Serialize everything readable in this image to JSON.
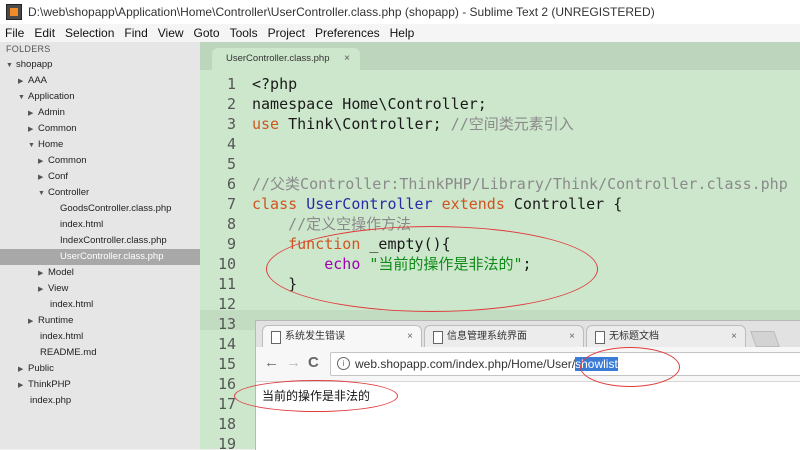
{
  "window": {
    "title": "D:\\web\\shopapp\\Application\\Home\\Controller\\UserController.class.php (shopapp) - Sublime Text 2 (UNREGISTERED)"
  },
  "menu": [
    "File",
    "Edit",
    "Selection",
    "Find",
    "View",
    "Goto",
    "Tools",
    "Project",
    "Preferences",
    "Help"
  ],
  "sidebar": {
    "header": "FOLDERS",
    "items": [
      {
        "label": "shopapp",
        "arrow": "▼"
      },
      {
        "label": "AAA",
        "arrow": "▶"
      },
      {
        "label": "Application",
        "arrow": "▼"
      },
      {
        "label": "Admin",
        "arrow": "▶"
      },
      {
        "label": "Common",
        "arrow": "▶"
      },
      {
        "label": "Home",
        "arrow": "▼"
      },
      {
        "label": "Common",
        "arrow": "▶"
      },
      {
        "label": "Conf",
        "arrow": "▶"
      },
      {
        "label": "Controller",
        "arrow": "▼"
      },
      {
        "label": "GoodsController.class.php",
        "arrow": ""
      },
      {
        "label": "index.html",
        "arrow": ""
      },
      {
        "label": "IndexController.class.php",
        "arrow": ""
      },
      {
        "label": "UserController.class.php",
        "arrow": "",
        "selected": true
      },
      {
        "label": "Model",
        "arrow": "▶"
      },
      {
        "label": "View",
        "arrow": "▶"
      },
      {
        "label": "index.html",
        "arrow": ""
      },
      {
        "label": "Runtime",
        "arrow": "▶"
      },
      {
        "label": "index.html",
        "arrow": ""
      },
      {
        "label": "README.md",
        "arrow": ""
      },
      {
        "label": "Public",
        "arrow": "▶"
      },
      {
        "label": "ThinkPHP",
        "arrow": "▶"
      },
      {
        "label": "index.php",
        "arrow": ""
      }
    ]
  },
  "editor": {
    "tab_label": "UserController.class.php",
    "tab_close": "×",
    "line_numbers": [
      "1",
      "2",
      "3",
      "4",
      "5",
      "6",
      "7",
      "8",
      "9",
      "10",
      "11",
      "12",
      "13",
      "14",
      "15",
      "16",
      "17",
      "18",
      "19"
    ],
    "code": {
      "l1": "<?php",
      "l2": "namespace Home\\Controller;",
      "l3_kw": "use",
      "l3_rest": " Think\\Controller; ",
      "l3_cmt": "//空间类元素引入",
      "l6_cmt": "//父类Controller:ThinkPHP/Library/Think/Controller.class.php",
      "l7_kw": "class",
      "l7_cls": "UserController",
      "l7_ext": "extends",
      "l7_parent": "Controller {",
      "l8_cmt": "//定义空操作方法",
      "l9_kw": "function",
      "l9_fn": "_empty(){",
      "l10_echo": "echo",
      "l10_str": "\"当前的操作是非法的\"",
      "l10_end": ";",
      "l11": "}"
    }
  },
  "browser": {
    "tabs": [
      "系统发生错误",
      "信息管理系统界面",
      "无标题文档"
    ],
    "tab_close": "×",
    "nav": {
      "back": "←",
      "forward": "→",
      "reload": "C"
    },
    "url_prefix": "web.shopapp.com/index.php/Home/User/",
    "url_selected": "showlist",
    "info": "i",
    "page_text": "当前的操作是非法的"
  }
}
